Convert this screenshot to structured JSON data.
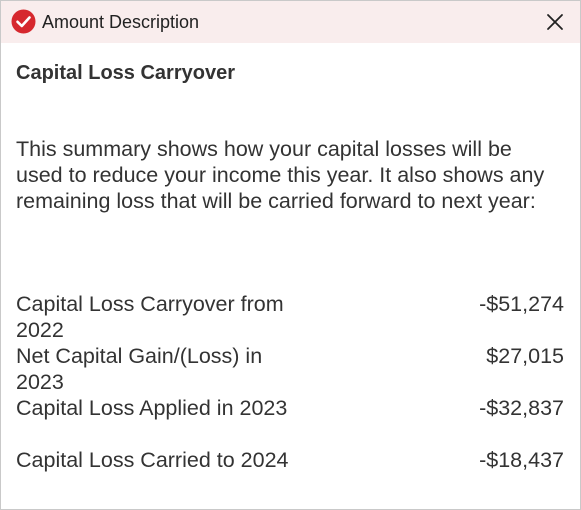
{
  "window": {
    "title": "Amount Description",
    "icon": "check-circle-icon",
    "close_icon": "close-icon"
  },
  "content": {
    "heading": "Capital Loss Carryover",
    "intro": "This summary shows how your capital losses will be used to reduce your income this year. It also shows any remaining loss that will be carried forward to next year:",
    "rows": [
      {
        "label": "Capital Loss Carryover from 2022",
        "value": "-$51,274"
      },
      {
        "label": "Net Capital Gain/(Loss) in 2023",
        "value": "$27,015"
      },
      {
        "label": "Capital Loss Applied in 2023",
        "value": "-$32,837"
      },
      {
        "label": "Capital Loss Carried to 2024",
        "value": "-$18,437"
      }
    ]
  },
  "colors": {
    "titlebar_bg": "#f9eded",
    "icon_red": "#d6282e",
    "text": "#333333"
  }
}
